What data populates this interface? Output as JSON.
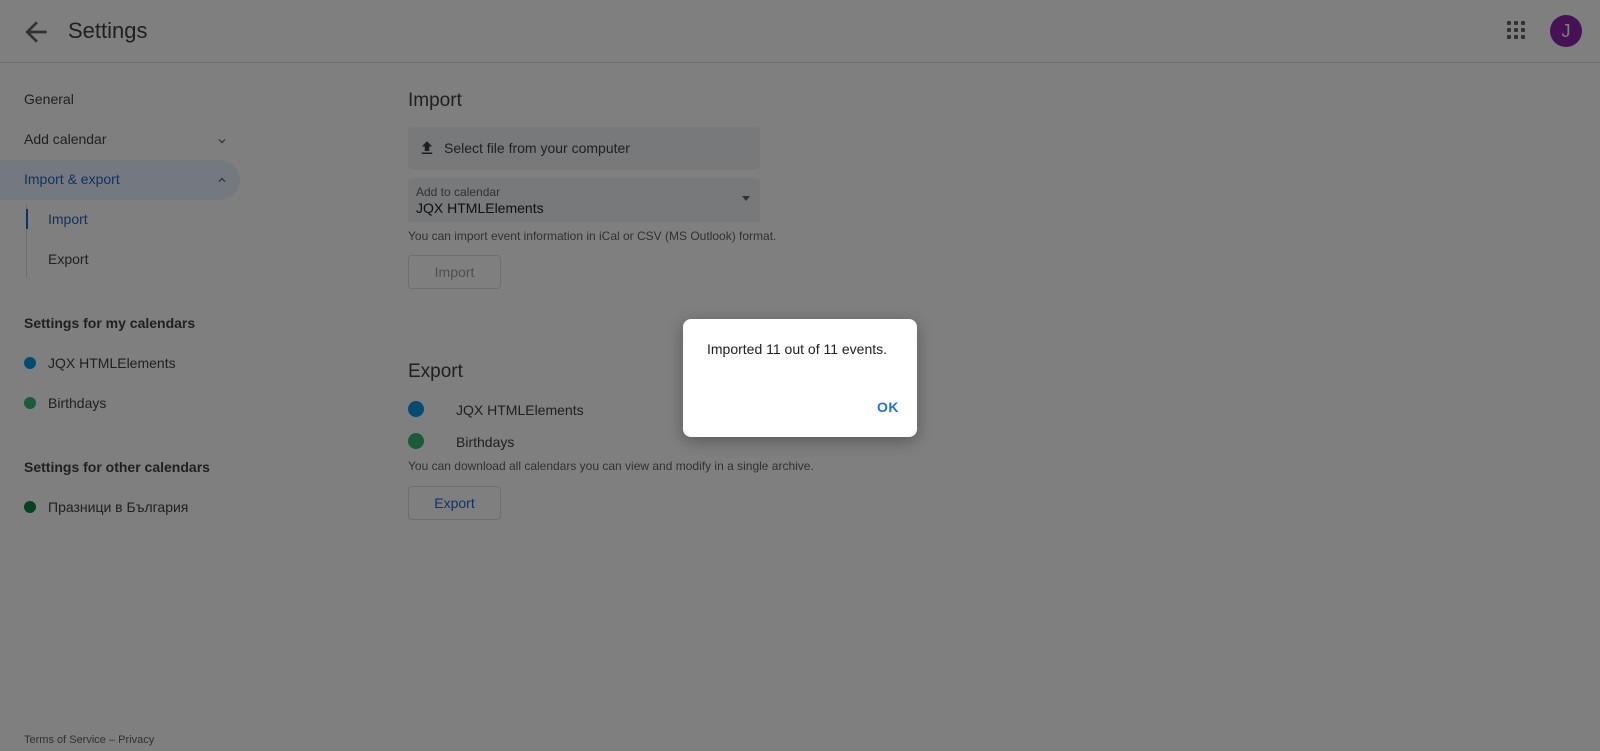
{
  "header": {
    "title": "Settings",
    "avatar_letter": "J",
    "avatar_color": "#8e24aa"
  },
  "sidebar": {
    "general": "General",
    "add_calendar": "Add calendar",
    "import_export": "Import & export",
    "sub_import": "Import",
    "sub_export": "Export",
    "my_calendars_heading": "Settings for my calendars",
    "my_calendars": [
      {
        "label": "JQX HTMLElements",
        "color": "#039be5"
      },
      {
        "label": "Birthdays",
        "color": "#33b679"
      }
    ],
    "other_calendars_heading": "Settings for other calendars",
    "other_calendars": [
      {
        "label": "Празници в България",
        "color": "#0b8043"
      }
    ]
  },
  "footer": {
    "terms": "Terms of Service",
    "sep": " – ",
    "privacy": "Privacy"
  },
  "import": {
    "title": "Import",
    "select_file": "Select file from your computer",
    "add_to_label": "Add to calendar",
    "add_to_value": "JQX HTMLElements",
    "hint": "You can import event information in iCal or CSV (MS Outlook) format.",
    "button": "Import"
  },
  "export": {
    "title": "Export",
    "calendars": [
      {
        "label": "JQX HTMLElements",
        "color": "#039be5"
      },
      {
        "label": "Birthdays",
        "color": "#33b679"
      }
    ],
    "hint": "You can download all calendars you can view and modify in a single archive.",
    "button": "Export"
  },
  "dialog": {
    "message": "Imported 11 out of 11 events.",
    "ok": "OK"
  }
}
